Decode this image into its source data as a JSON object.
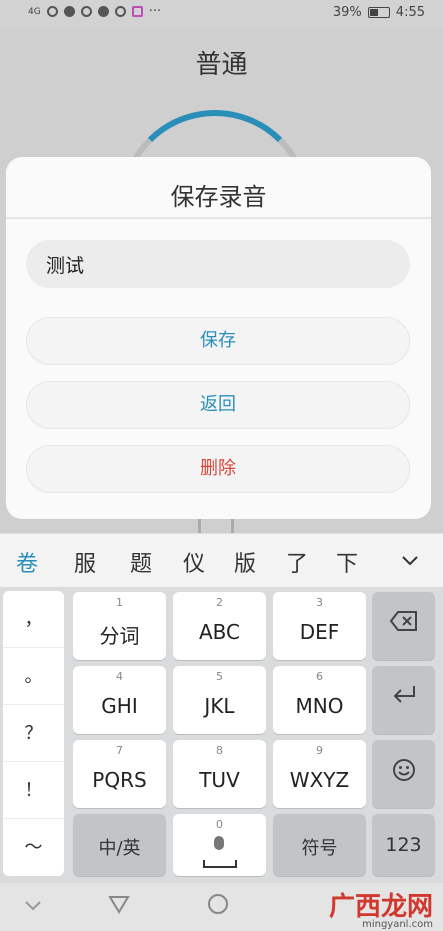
{
  "status_bar": {
    "left_signal": "4G",
    "battery": "39%",
    "battery_level": 0.39,
    "time": "4:55",
    "more": "···"
  },
  "app": {
    "title": "普通"
  },
  "dialog": {
    "title": "保存录音",
    "input_value": "测试",
    "save_label": "保存",
    "back_label": "返回",
    "delete_label": "删除",
    "accent_color": "#2a8fb8",
    "danger_color": "#d9463a"
  },
  "candidates": [
    "卷",
    "服",
    "题",
    "仪",
    "版",
    "了",
    "下"
  ],
  "candidates_expand_icon": "chevron-down-icon",
  "punctuation": [
    "，",
    "。",
    "？",
    "！",
    "～"
  ],
  "keys": [
    {
      "num": "1",
      "label": "分词"
    },
    {
      "num": "2",
      "label": "ABC"
    },
    {
      "num": "3",
      "label": "DEF"
    },
    {
      "num": "4",
      "label": "GHI"
    },
    {
      "num": "5",
      "label": "JKL"
    },
    {
      "num": "6",
      "label": "MNO"
    },
    {
      "num": "7",
      "label": "PQRS"
    },
    {
      "num": "8",
      "label": "TUV"
    },
    {
      "num": "9",
      "label": "WXYZ"
    }
  ],
  "bottom_row": {
    "lang": "中/英",
    "space_num": "0",
    "symbols": "符号",
    "numbers": "123"
  },
  "side_keys": {
    "backspace_icon": "backspace-icon",
    "enter_icon": "enter-icon",
    "emoji_icon": "emoji-icon"
  },
  "watermark": {
    "main": "广西龙网",
    "sub": "mingyanl.com"
  }
}
